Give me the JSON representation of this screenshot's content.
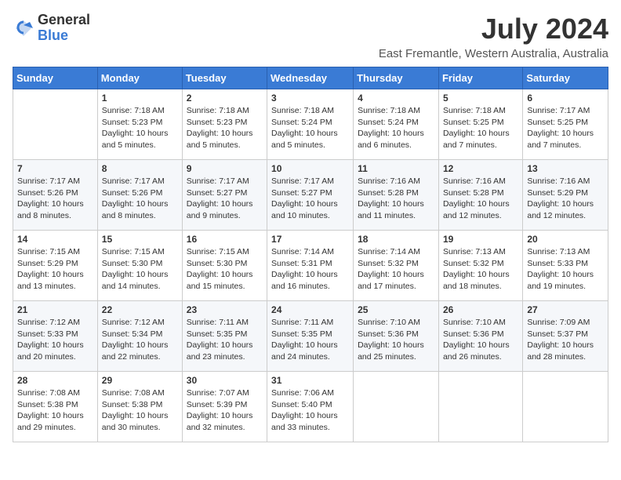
{
  "logo": {
    "general": "General",
    "blue": "Blue"
  },
  "title": "July 2024",
  "location": "East Fremantle, Western Australia, Australia",
  "days_header": [
    "Sunday",
    "Monday",
    "Tuesday",
    "Wednesday",
    "Thursday",
    "Friday",
    "Saturday"
  ],
  "weeks": [
    [
      {
        "day": "",
        "info": ""
      },
      {
        "day": "1",
        "info": "Sunrise: 7:18 AM\nSunset: 5:23 PM\nDaylight: 10 hours and 5 minutes."
      },
      {
        "day": "2",
        "info": "Sunrise: 7:18 AM\nSunset: 5:23 PM\nDaylight: 10 hours and 5 minutes."
      },
      {
        "day": "3",
        "info": "Sunrise: 7:18 AM\nSunset: 5:24 PM\nDaylight: 10 hours and 5 minutes."
      },
      {
        "day": "4",
        "info": "Sunrise: 7:18 AM\nSunset: 5:24 PM\nDaylight: 10 hours and 6 minutes."
      },
      {
        "day": "5",
        "info": "Sunrise: 7:18 AM\nSunset: 5:25 PM\nDaylight: 10 hours and 7 minutes."
      },
      {
        "day": "6",
        "info": "Sunrise: 7:17 AM\nSunset: 5:25 PM\nDaylight: 10 hours and 7 minutes."
      }
    ],
    [
      {
        "day": "7",
        "info": "Sunrise: 7:17 AM\nSunset: 5:26 PM\nDaylight: 10 hours and 8 minutes."
      },
      {
        "day": "8",
        "info": "Sunrise: 7:17 AM\nSunset: 5:26 PM\nDaylight: 10 hours and 8 minutes."
      },
      {
        "day": "9",
        "info": "Sunrise: 7:17 AM\nSunset: 5:27 PM\nDaylight: 10 hours and 9 minutes."
      },
      {
        "day": "10",
        "info": "Sunrise: 7:17 AM\nSunset: 5:27 PM\nDaylight: 10 hours and 10 minutes."
      },
      {
        "day": "11",
        "info": "Sunrise: 7:16 AM\nSunset: 5:28 PM\nDaylight: 10 hours and 11 minutes."
      },
      {
        "day": "12",
        "info": "Sunrise: 7:16 AM\nSunset: 5:28 PM\nDaylight: 10 hours and 12 minutes."
      },
      {
        "day": "13",
        "info": "Sunrise: 7:16 AM\nSunset: 5:29 PM\nDaylight: 10 hours and 12 minutes."
      }
    ],
    [
      {
        "day": "14",
        "info": "Sunrise: 7:15 AM\nSunset: 5:29 PM\nDaylight: 10 hours and 13 minutes."
      },
      {
        "day": "15",
        "info": "Sunrise: 7:15 AM\nSunset: 5:30 PM\nDaylight: 10 hours and 14 minutes."
      },
      {
        "day": "16",
        "info": "Sunrise: 7:15 AM\nSunset: 5:30 PM\nDaylight: 10 hours and 15 minutes."
      },
      {
        "day": "17",
        "info": "Sunrise: 7:14 AM\nSunset: 5:31 PM\nDaylight: 10 hours and 16 minutes."
      },
      {
        "day": "18",
        "info": "Sunrise: 7:14 AM\nSunset: 5:32 PM\nDaylight: 10 hours and 17 minutes."
      },
      {
        "day": "19",
        "info": "Sunrise: 7:13 AM\nSunset: 5:32 PM\nDaylight: 10 hours and 18 minutes."
      },
      {
        "day": "20",
        "info": "Sunrise: 7:13 AM\nSunset: 5:33 PM\nDaylight: 10 hours and 19 minutes."
      }
    ],
    [
      {
        "day": "21",
        "info": "Sunrise: 7:12 AM\nSunset: 5:33 PM\nDaylight: 10 hours and 20 minutes."
      },
      {
        "day": "22",
        "info": "Sunrise: 7:12 AM\nSunset: 5:34 PM\nDaylight: 10 hours and 22 minutes."
      },
      {
        "day": "23",
        "info": "Sunrise: 7:11 AM\nSunset: 5:35 PM\nDaylight: 10 hours and 23 minutes."
      },
      {
        "day": "24",
        "info": "Sunrise: 7:11 AM\nSunset: 5:35 PM\nDaylight: 10 hours and 24 minutes."
      },
      {
        "day": "25",
        "info": "Sunrise: 7:10 AM\nSunset: 5:36 PM\nDaylight: 10 hours and 25 minutes."
      },
      {
        "day": "26",
        "info": "Sunrise: 7:10 AM\nSunset: 5:36 PM\nDaylight: 10 hours and 26 minutes."
      },
      {
        "day": "27",
        "info": "Sunrise: 7:09 AM\nSunset: 5:37 PM\nDaylight: 10 hours and 28 minutes."
      }
    ],
    [
      {
        "day": "28",
        "info": "Sunrise: 7:08 AM\nSunset: 5:38 PM\nDaylight: 10 hours and 29 minutes."
      },
      {
        "day": "29",
        "info": "Sunrise: 7:08 AM\nSunset: 5:38 PM\nDaylight: 10 hours and 30 minutes."
      },
      {
        "day": "30",
        "info": "Sunrise: 7:07 AM\nSunset: 5:39 PM\nDaylight: 10 hours and 32 minutes."
      },
      {
        "day": "31",
        "info": "Sunrise: 7:06 AM\nSunset: 5:40 PM\nDaylight: 10 hours and 33 minutes."
      },
      {
        "day": "",
        "info": ""
      },
      {
        "day": "",
        "info": ""
      },
      {
        "day": "",
        "info": ""
      }
    ]
  ]
}
